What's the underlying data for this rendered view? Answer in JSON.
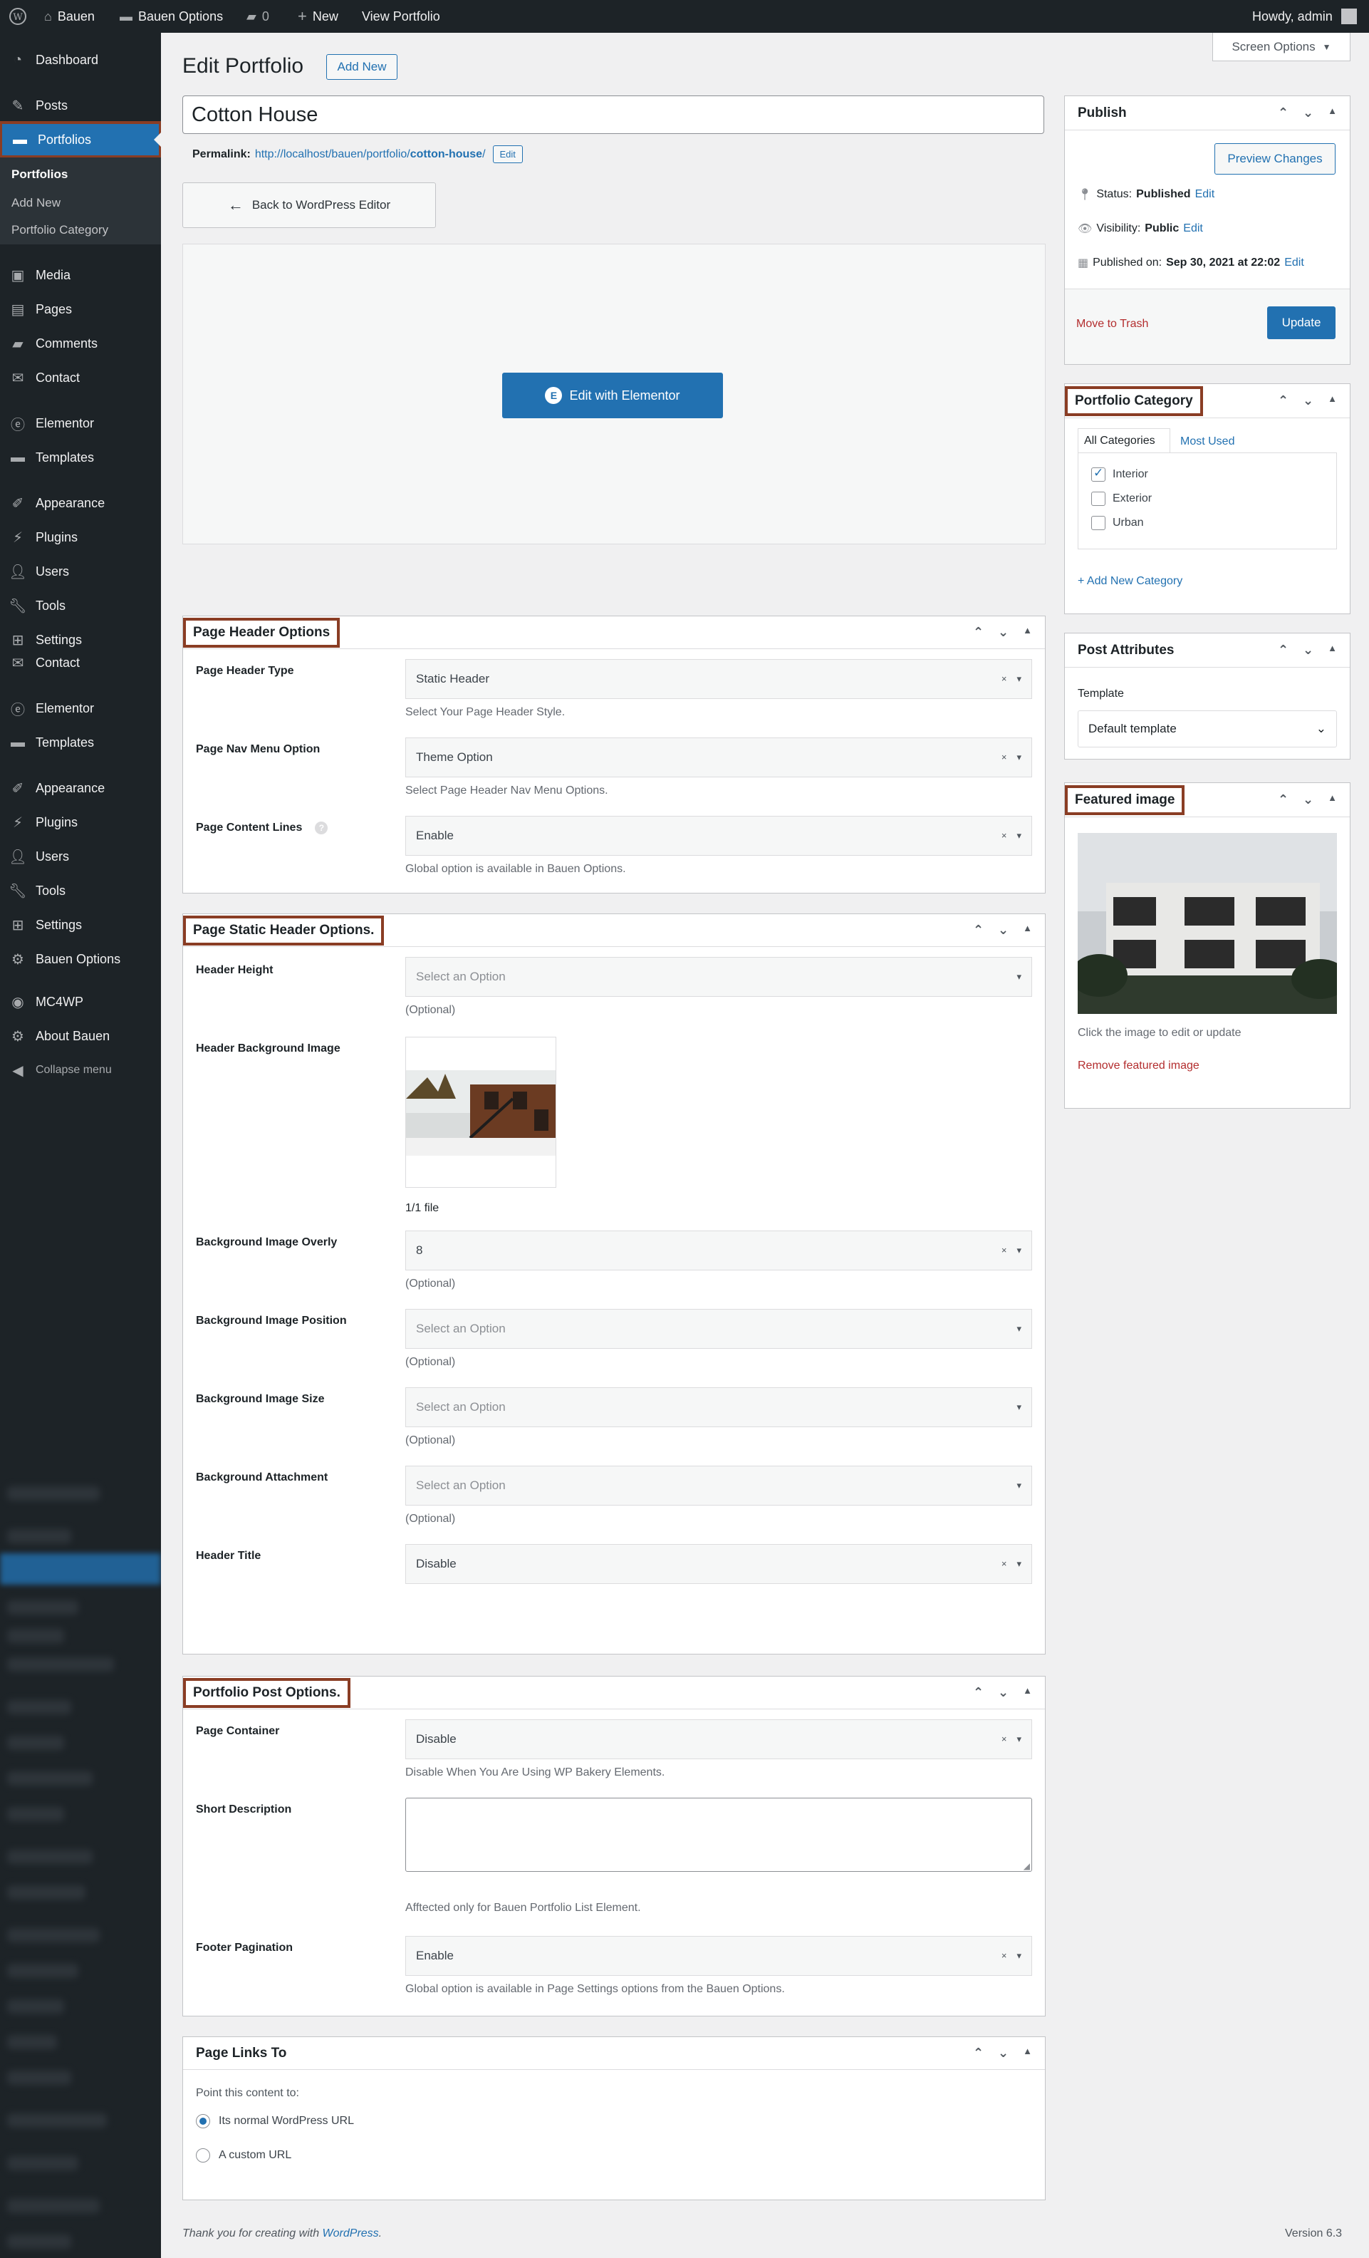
{
  "adminbar": {
    "site": "Bauen",
    "options": "Bauen Options",
    "comments": "0",
    "new": "New",
    "view": "View Portfolio",
    "howdy": "Howdy, admin"
  },
  "menu": {
    "dashboard": "Dashboard",
    "posts": "Posts",
    "portfolios": "Portfolios",
    "sub_portfolios": "Portfolios",
    "sub_add_new": "Add New",
    "sub_category": "Portfolio Category",
    "media": "Media",
    "pages": "Pages",
    "comments": "Comments",
    "contact": "Contact",
    "elementor": "Elementor",
    "templates": "Templates",
    "appearance": "Appearance",
    "plugins": "Plugins",
    "users": "Users",
    "tools": "Tools",
    "settings": "Settings",
    "contact2": "Contact",
    "elementor2": "Elementor",
    "templates2": "Templates",
    "appearance2": "Appearance",
    "plugins2": "Plugins",
    "users2": "Users",
    "tools2": "Tools",
    "settings2": "Settings",
    "bauen_options": "Bauen Options",
    "mc4wp": "MC4WP",
    "about": "About Bauen",
    "collapse": "Collapse menu"
  },
  "header": {
    "title": "Edit Portfolio",
    "add_new": "Add New",
    "screen_options": "Screen Options"
  },
  "post": {
    "title": "Cotton House",
    "permalink_label": "Permalink:",
    "permalink_base": "http://localhost/bauen/portfolio/",
    "permalink_slug": "cotton-house",
    "permalink_tail": "/",
    "edit": "Edit",
    "back_button": "Back to WordPress Editor",
    "elementor_button": "Edit with Elementor"
  },
  "publish": {
    "title": "Publish",
    "preview": "Preview Changes",
    "status_label": "Status:",
    "status": "Published",
    "edit": "Edit",
    "visibility_label": "Visibility:",
    "visibility": "Public",
    "published_label": "Published on:",
    "published": "Sep 30, 2021 at 22:02",
    "trash": "Move to Trash",
    "update": "Update"
  },
  "category": {
    "title": "Portfolio Category",
    "tab_all": "All Categories",
    "tab_used": "Most Used",
    "items": [
      {
        "label": "Interior",
        "checked": true
      },
      {
        "label": "Exterior",
        "checked": false
      },
      {
        "label": "Urban",
        "checked": false
      }
    ],
    "add_new": "+ Add New Category"
  },
  "attributes": {
    "title": "Post Attributes",
    "template_label": "Template",
    "template_value": "Default template"
  },
  "featured": {
    "title": "Featured image",
    "hint": "Click the image to edit or update",
    "remove": "Remove featured image"
  },
  "page_header": {
    "title": "Page Header Options",
    "type_label": "Page Header Type",
    "type_value": "Static Header",
    "type_help": "Select Your Page Header Style.",
    "nav_label": "Page Nav Menu Option",
    "nav_value": "Theme Option",
    "nav_help": "Select Page Header Nav Menu Options.",
    "lines_label": "Page Content Lines",
    "lines_value": "Enable",
    "lines_help": "Global option is available in Bauen Options."
  },
  "static_header": {
    "title": "Page Static Header Options.",
    "height_label": "Header Height",
    "placeholder": "Select an Option",
    "optional": "(Optional)",
    "bg_label": "Header Background Image",
    "file_count": "1/1 file",
    "overlay_label": "Background Image Overly",
    "overlay_value": "8",
    "position_label": "Background Image Position",
    "size_label": "Background Image Size",
    "attachment_label": "Background Attachment",
    "title_label": "Header Title",
    "title_value": "Disable"
  },
  "portfolio_post": {
    "title": "Portfolio Post Options.",
    "container_label": "Page Container",
    "container_value": "Disable",
    "container_help": "Disable When You Are Using WP Bakery Elements.",
    "short_label": "Short Description",
    "short_help": "Afftected only for Bauen Portfolio List Element.",
    "footer_label": "Footer Pagination",
    "footer_value": "Enable",
    "footer_help": "Global option is available in Page Settings options from the Bauen Options."
  },
  "links_to": {
    "title": "Page Links To",
    "intro": "Point this content to:",
    "opt1": "Its normal WordPress URL",
    "opt2": "A custom URL",
    "selected": 0
  },
  "footer": {
    "thanks": "Thank you for creating with",
    "wp": "WordPress",
    "period": ".",
    "version": "Version 6.3"
  }
}
